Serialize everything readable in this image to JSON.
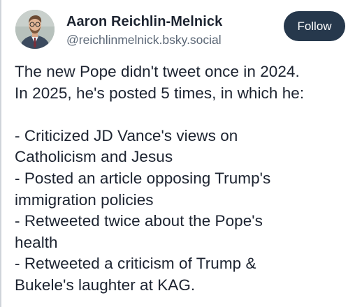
{
  "author": {
    "display_name": "Aaron Reichlin-Melnick",
    "handle": "@reichlinmelnick.bsky.social",
    "avatar_icon": "profile-photo"
  },
  "actions": {
    "follow_label": "Follow"
  },
  "post": {
    "lines": [
      "The new Pope didn't tweet once in 2024.",
      "In 2025, he's posted 5 times, in which he:",
      "",
      "- Criticized JD Vance's views on",
      "Catholicism and Jesus",
      "- Posted an article opposing Trump's",
      "immigration policies",
      "- Retweeted twice about the Pope's",
      "health",
      "- Retweeted a criticism of Trump &",
      "Bukele's laughter at KAG."
    ]
  },
  "colors": {
    "follow_button_bg": "#26384c",
    "text": "#1c2330",
    "handle_text": "#5b6776"
  }
}
